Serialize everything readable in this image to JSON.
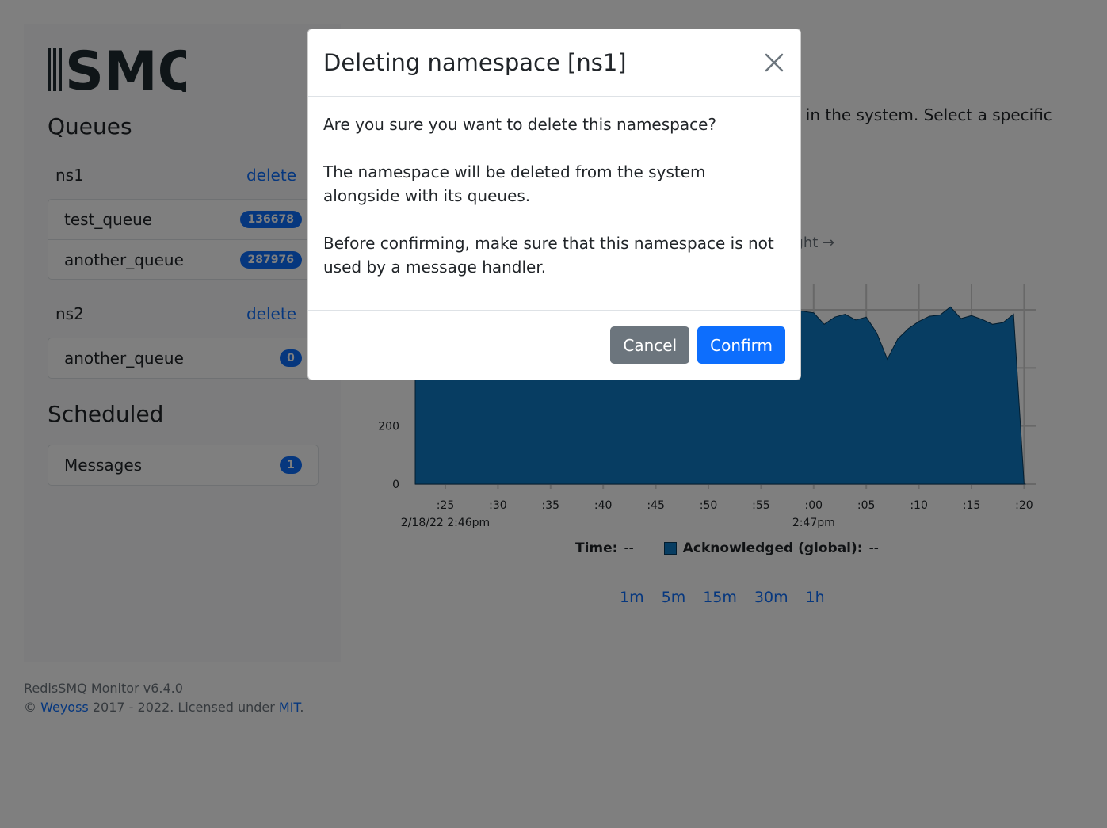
{
  "sidebar": {
    "logo_text": "SMQ",
    "queues_heading": "Queues",
    "namespaces": [
      {
        "name": "ns1",
        "delete_label": "delete",
        "queues": [
          {
            "name": "test_queue",
            "count": "136678"
          },
          {
            "name": "another_queue",
            "count": "287976"
          }
        ]
      },
      {
        "name": "ns2",
        "delete_label": "delete",
        "queues": [
          {
            "name": "another_queue",
            "count": "0"
          }
        ]
      }
    ],
    "scheduled_heading": "Scheduled",
    "scheduled_item": {
      "label": "Messages",
      "count": "1"
    }
  },
  "main": {
    "intro_text": "s in the system. Select a specific",
    "nav_hint": "right →",
    "chart_data": {
      "type": "area",
      "y_ticks": [
        "0",
        "200"
      ],
      "x_ticks": [
        ":25",
        ":30",
        ":35",
        ":40",
        ":45",
        ":50",
        ":55",
        ":00",
        ":05",
        ":10",
        ":15",
        ":20"
      ],
      "x_date_labels": [
        {
          "tick": ":25",
          "label": "2/18/22 2:46pm"
        },
        {
          "tick": ":00",
          "label": "2:47pm"
        }
      ],
      "series": [
        {
          "name": "Acknowledged (global)",
          "color": "#0e7ac4",
          "values": [
            {
              "x": ":58",
              "y": 600
            },
            {
              "x": ":00",
              "y": 590
            },
            {
              "x": ":01",
              "y": 550
            },
            {
              "x": ":02",
              "y": 575
            },
            {
              "x": ":03",
              "y": 585
            },
            {
              "x": ":04",
              "y": 565
            },
            {
              "x": ":05",
              "y": 575
            },
            {
              "x": ":06",
              "y": 520
            },
            {
              "x": ":07",
              "y": 430
            },
            {
              "x": ":08",
              "y": 500
            },
            {
              "x": ":09",
              "y": 535
            },
            {
              "x": ":10",
              "y": 560
            },
            {
              "x": ":11",
              "y": 578
            },
            {
              "x": ":12",
              "y": 582
            },
            {
              "x": ":13",
              "y": 610
            },
            {
              "x": ":14",
              "y": 570
            },
            {
              "x": ":15",
              "y": 580
            },
            {
              "x": ":16",
              "y": 567
            },
            {
              "x": ":17",
              "y": 550
            },
            {
              "x": ":18",
              "y": 556
            },
            {
              "x": ":19",
              "y": 585
            },
            {
              "x": ":20",
              "y": 0
            }
          ]
        }
      ]
    },
    "legend": {
      "time_label": "Time:",
      "time_value": "--",
      "series_label": "Acknowledged (global):",
      "series_value": "--"
    },
    "ranges": [
      "1m",
      "5m",
      "15m",
      "30m",
      "1h"
    ]
  },
  "footer": {
    "version": "RedisSMQ Monitor v6.4.0",
    "copyright": "©",
    "author": "Weyoss",
    "years": "2017 - 2022. Licensed under",
    "license": "MIT",
    "period": "."
  },
  "modal": {
    "title": "Deleting namespace [ns1]",
    "body_1": "Are you sure you want to delete this namespace?",
    "body_2": "The namespace will be deleted from the system alongside with its queues.",
    "body_3": "Before confirming, make sure that this namespace is not used by a message handler.",
    "cancel_label": "Cancel",
    "confirm_label": "Confirm"
  }
}
